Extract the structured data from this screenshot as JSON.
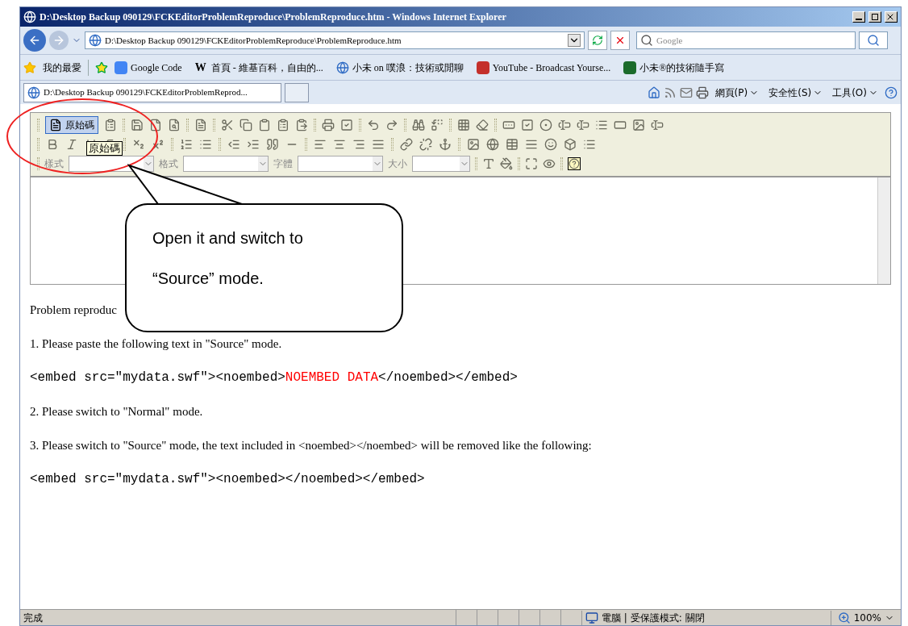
{
  "window": {
    "title": "D:\\Desktop Backup 090129\\FCKEditorProblemReproduce\\ProblemReproduce.htm - Windows Internet Explorer"
  },
  "address_bar": {
    "value": "D:\\Desktop Backup 090129\\FCKEditorProblemReproduce\\ProblemReproduce.htm"
  },
  "search": {
    "placeholder": "Google"
  },
  "favorites": {
    "label": "我的最愛",
    "items": [
      {
        "label": "Google Code",
        "kind": "google"
      },
      {
        "label": "首頁 - 維基百科，自由的...",
        "kind": "wiki",
        "icon": "W"
      },
      {
        "label": "小未 on 噗浪：技術或閒聊",
        "kind": "ie"
      },
      {
        "label": "YouTube - Broadcast Yourse...",
        "kind": "youtube"
      },
      {
        "label": "小未®的技術隨手寫",
        "kind": "blog"
      }
    ]
  },
  "tabs": [
    {
      "label": "D:\\Desktop Backup 090129\\FCKEditorProblemReprod...",
      "selected": true
    }
  ],
  "command_bar": [
    "網頁(P)",
    "安全性(S)",
    "工具(O)"
  ],
  "editor": {
    "source_button": {
      "label": "原始碼",
      "selected": true
    },
    "tooltip": "原始碼",
    "combos": [
      "樣式",
      "格式",
      "字體",
      "大小"
    ]
  },
  "content": [
    {
      "kind": "text",
      "text": "Problem reproduc"
    },
    {
      "kind": "text",
      "text": "1. Please paste the following text in \"Source\" mode."
    },
    {
      "kind": "code",
      "segments": [
        {
          "text": "<embed src=\"mydata.swf\"><noembed>",
          "color": "#000000"
        },
        {
          "text": "NOEMBED DATA",
          "color": "#ff0000"
        },
        {
          "text": "</noembed></embed>",
          "color": "#000000"
        }
      ]
    },
    {
      "kind": "text",
      "text": "2. Please switch to \"Normal\" mode."
    },
    {
      "kind": "text",
      "text": "3. Please switch to \"Source\" mode, the text included in <noembed></noembed> will be removed like the following:"
    },
    {
      "kind": "code",
      "segments": [
        {
          "text": "<embed src=\"mydata.swf\"><noembed></noembed></embed>",
          "color": "#000000"
        }
      ]
    }
  ],
  "callout": {
    "lines": [
      "Open it and switch to",
      "“Source” mode."
    ]
  },
  "status_bar": {
    "text": "完成",
    "zone": "電腦 | 受保護模式: 關閉",
    "zoom": "100%"
  }
}
